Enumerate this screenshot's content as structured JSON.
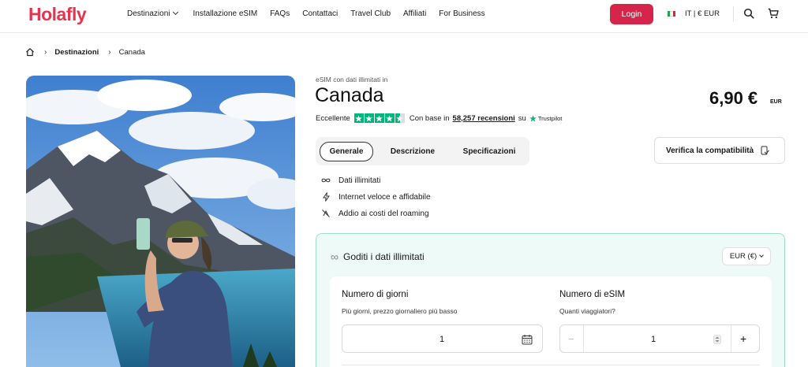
{
  "header": {
    "logo": "Holafly",
    "nav": [
      "Destinazioni",
      "Installazione eSIM",
      "FAQs",
      "Contattaci",
      "Travel Club",
      "Affiliati",
      "For Business"
    ],
    "login_label": "Login",
    "locale_label": "IT | € EUR",
    "icons": [
      "search-icon",
      "cart-icon"
    ]
  },
  "breadcrumb": {
    "items": [
      "Destinazioni",
      "Canada"
    ]
  },
  "product": {
    "subtitle": "eSIM con dati illimitati in",
    "title": "Canada",
    "price": "6,90 €",
    "currency": "EUR",
    "rating_word": "Eccellente",
    "rating_prefix": "Con base in",
    "reviews_count": "58,257 recensioni",
    "rating_suffix": "su",
    "trustpilot": "Trustpilot",
    "stars": 4.5
  },
  "tabs": [
    "Generale",
    "Descrizione",
    "Specificazioni"
  ],
  "verify_label": "Verifica la compatibilità",
  "features": [
    "Dati illimitati",
    "Internet veloce e affidabile",
    "Addio ai costi del roaming"
  ],
  "plan": {
    "title": "Goditi i dati illimitati",
    "currency_select": "EUR (€)",
    "days": {
      "label": "Numero di giorni",
      "hint": "Più giorni, prezzo giornaliero più basso",
      "value": "1"
    },
    "esims": {
      "label": "Numero di eSIM",
      "hint": "Quanti viaggiatori?",
      "value": "1",
      "minus": "−",
      "plus": "+"
    }
  },
  "colors": {
    "brand": "#e5344f",
    "login": "#d6254a",
    "trustpilot_green": "#00b67a",
    "plan_bg": "#eefaf8",
    "plan_border": "#9fdcc8"
  }
}
